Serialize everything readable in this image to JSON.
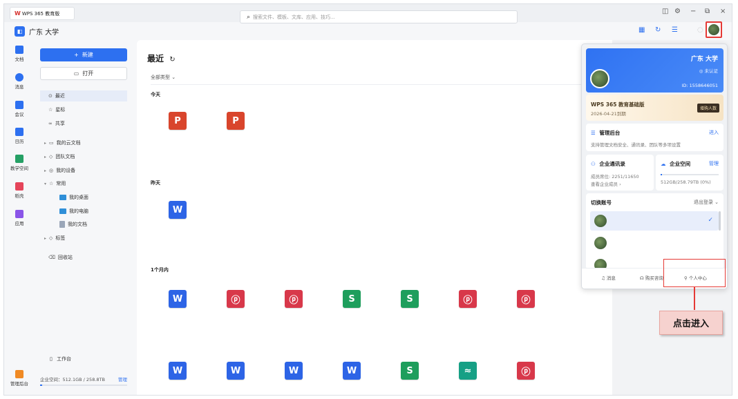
{
  "titlebar": {
    "tab_logo": "W",
    "tab_title": "WPS 365 教育版"
  },
  "brand": {
    "name": "广东    大学"
  },
  "search": {
    "placeholder": "搜索文件、模板、文库、应用、技巧..."
  },
  "leftnav": [
    {
      "label": "文档",
      "icon": "document-icon",
      "color": "#2d70f0"
    },
    {
      "label": "消息",
      "icon": "message-icon",
      "color": "#2d70f0"
    },
    {
      "label": "会议",
      "icon": "meeting-icon",
      "color": "#2d70f0"
    },
    {
      "label": "日历",
      "icon": "calendar-icon",
      "color": "#2d70f0"
    },
    {
      "label": "教学空间",
      "icon": "teaching-space-icon",
      "color": "#25a065"
    },
    {
      "label": "稻壳",
      "icon": "docer-icon",
      "color": "#e5455a"
    },
    {
      "label": "应用",
      "icon": "apps-icon",
      "color": "#8a55e8"
    },
    {
      "label": "管理后台",
      "icon": "admin-icon",
      "color": "#f08a24"
    }
  ],
  "sidebar": {
    "new_label": "新建",
    "open_label": "打开",
    "items": [
      {
        "label": "最近",
        "icon": "⊙"
      },
      {
        "label": "星标",
        "icon": "☆"
      },
      {
        "label": "共享",
        "icon": "∞"
      },
      {
        "label": "我的云文档",
        "icon": "▭"
      },
      {
        "label": "团队文档",
        "icon": "◇"
      },
      {
        "label": "我的设备",
        "icon": "◎"
      },
      {
        "label": "常用",
        "icon": "☆"
      },
      {
        "label": "我的桌面",
        "icon": ""
      },
      {
        "label": "我的电脑",
        "icon": ""
      },
      {
        "label": "我的文档",
        "icon": ""
      },
      {
        "label": "标签",
        "icon": "◇"
      },
      {
        "label": "回收站",
        "icon": "⌫"
      }
    ],
    "workbench": "工作台",
    "storage": "企业空间：512.1GB / 258.8TB",
    "manage": "管理"
  },
  "main": {
    "title": "最近",
    "filter": "全部类型",
    "sections": [
      {
        "label": "今天"
      },
      {
        "label": "昨天"
      },
      {
        "label": "1个月内"
      }
    ]
  },
  "files": {
    "today": [
      {
        "letter": "P",
        "color": "#d9452c"
      },
      {
        "letter": "P",
        "color": "#d9452c"
      }
    ],
    "yesterday": [
      {
        "letter": "W",
        "color": "#2d64e6"
      }
    ],
    "month_row1": [
      {
        "letter": "W",
        "color": "#2d64e6"
      },
      {
        "letter": "ⓟ",
        "color": "#d8384a"
      },
      {
        "letter": "ⓟ",
        "color": "#d8384a"
      },
      {
        "letter": "S",
        "color": "#1e9e5c"
      },
      {
        "letter": "S",
        "color": "#1e9e5c"
      },
      {
        "letter": "ⓟ",
        "color": "#d8384a"
      },
      {
        "letter": "ⓟ",
        "color": "#d8384a"
      }
    ],
    "month_row2": [
      {
        "letter": "W",
        "color": "#2d64e6"
      },
      {
        "letter": "W",
        "color": "#2d64e6"
      },
      {
        "letter": "W",
        "color": "#2d64e6"
      },
      {
        "letter": "W",
        "color": "#2d64e6"
      },
      {
        "letter": "S",
        "color": "#1e9e5c"
      },
      {
        "letter": "≈",
        "color": "#16a085"
      },
      {
        "letter": "ⓟ",
        "color": "#d8384a"
      }
    ]
  },
  "panel": {
    "user_name": "广东    大学",
    "verify": "未认证",
    "user_id": "ID: 1558646051",
    "edition": "WPS 365 教育基础版",
    "expiry": "2026-04-21到期",
    "buy_label": "增购人数",
    "admin_title": "管理后台",
    "admin_link": "进入",
    "admin_desc": "支持管理文档安全、通讯录、团队等多项设置",
    "contacts_title": "企业通讯录",
    "contacts_seats": "成员席位: 2251/11650",
    "contacts_view": "查看企业成员 ›",
    "space_title": "企业空间",
    "space_manage": "管理",
    "space_usage": "512GB/258.79TB (0%)",
    "space_fraction": 0.02,
    "switch_title": "切换账号",
    "logout": "退出登录",
    "foot_msg": "消息",
    "foot_service": "购买咨询",
    "foot_personal": "个人中心"
  },
  "callout": {
    "label": "点击进入"
  }
}
